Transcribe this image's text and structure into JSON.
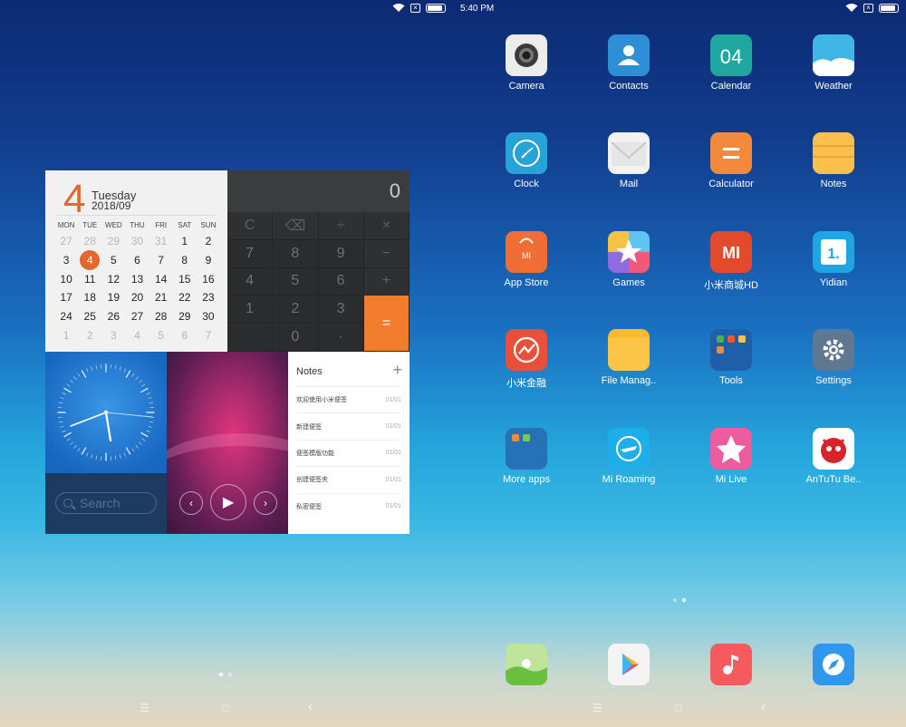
{
  "status": {
    "time": "5:40 PM"
  },
  "calendar": {
    "big_day": "4",
    "weekday": "Tuesday",
    "year_month": "2018/09",
    "week_headers": [
      "MON",
      "TUE",
      "WED",
      "THU",
      "FRI",
      "SAT",
      "SUN"
    ],
    "rows": [
      [
        "27",
        "28",
        "29",
        "30",
        "31",
        "1",
        "2"
      ],
      [
        "3",
        "4",
        "5",
        "6",
        "7",
        "8",
        "9"
      ],
      [
        "10",
        "11",
        "12",
        "13",
        "14",
        "15",
        "16"
      ],
      [
        "17",
        "18",
        "19",
        "20",
        "21",
        "22",
        "23"
      ],
      [
        "24",
        "25",
        "26",
        "27",
        "28",
        "29",
        "30"
      ],
      [
        "1",
        "2",
        "3",
        "4",
        "5",
        "6",
        "7"
      ]
    ],
    "today": "4"
  },
  "calculator": {
    "display": "0",
    "keys": [
      "C",
      "⌫",
      "÷",
      "×",
      "7",
      "8",
      "9",
      "−",
      "4",
      "5",
      "6",
      "+",
      "1",
      "2",
      "3",
      "=",
      "",
      "0",
      "·"
    ]
  },
  "search": {
    "placeholder": "Search"
  },
  "notes": {
    "title": "Notes",
    "add": "+",
    "items": [
      {
        "text": "欢迎使用小米便签",
        "date": "01/01"
      },
      {
        "text": "新建便签",
        "date": "01/01"
      },
      {
        "text": "便签模版功能",
        "date": "01/01"
      },
      {
        "text": "创建便签夹",
        "date": "01/01"
      },
      {
        "text": "私密便签",
        "date": "01/01"
      }
    ]
  },
  "apps": [
    {
      "label": "Camera",
      "icon": "camera-icon",
      "color": "#ececec"
    },
    {
      "label": "Contacts",
      "icon": "contacts-icon",
      "color": "#2f8fd6"
    },
    {
      "label": "Calendar",
      "icon": "calendar-icon",
      "color": "#1fa7a0",
      "text": "04"
    },
    {
      "label": "Weather",
      "icon": "weather-icon",
      "color": "#3fb6e6"
    },
    {
      "label": "Clock",
      "icon": "clock-icon",
      "color": "#28a3d9"
    },
    {
      "label": "Mail",
      "icon": "mail-icon",
      "color": "#f2f2f2"
    },
    {
      "label": "Calculator",
      "icon": "calculator-icon",
      "color": "#f3893b"
    },
    {
      "label": "Notes",
      "icon": "notes-icon",
      "color": "#fbbf4b"
    },
    {
      "label": "App Store",
      "icon": "app-store-icon",
      "color": "#f06d35",
      "text": "MI"
    },
    {
      "label": "Games",
      "icon": "games-icon",
      "color": "#7a66d8"
    },
    {
      "label": "小米商城HD",
      "icon": "mi-store-icon",
      "color": "#e24a2b",
      "text": "MI"
    },
    {
      "label": "Yidian",
      "icon": "yidian-icon",
      "color": "#1fa4e4",
      "text": "1."
    },
    {
      "label": "小米金融",
      "icon": "mi-finance-icon",
      "color": "#e8503a"
    },
    {
      "label": "File Manag..",
      "icon": "folder-icon",
      "color": "#fbb92f"
    },
    {
      "label": "Tools",
      "icon": "tools-folder-icon",
      "color": "#1f5fa8"
    },
    {
      "label": "Settings",
      "icon": "gear-icon",
      "color": "#5f7791"
    },
    {
      "label": "More apps",
      "icon": "more-apps-folder-icon",
      "color": "#2672b6"
    },
    {
      "label": "Mi Roaming",
      "icon": "airplane-icon",
      "color": "#1eaeea"
    },
    {
      "label": "Mi Live",
      "icon": "mi-live-icon",
      "color": "#ee5ba0"
    },
    {
      "label": "AnTuTu Be..",
      "icon": "antutu-icon",
      "color": "#ffffff"
    }
  ],
  "dock": [
    {
      "icon": "gallery-icon",
      "color": "#a6d98b"
    },
    {
      "icon": "play-store-icon",
      "color": "#f4f4f4"
    },
    {
      "icon": "music-icon",
      "color": "#f55a5f"
    },
    {
      "icon": "browser-icon",
      "color": "#2f97ee"
    }
  ],
  "nav": {
    "menu": "☰",
    "home": "□",
    "back": "‹"
  },
  "colors": {
    "accent_orange": "#e6672d",
    "calc_equal": "#f07c2c"
  }
}
